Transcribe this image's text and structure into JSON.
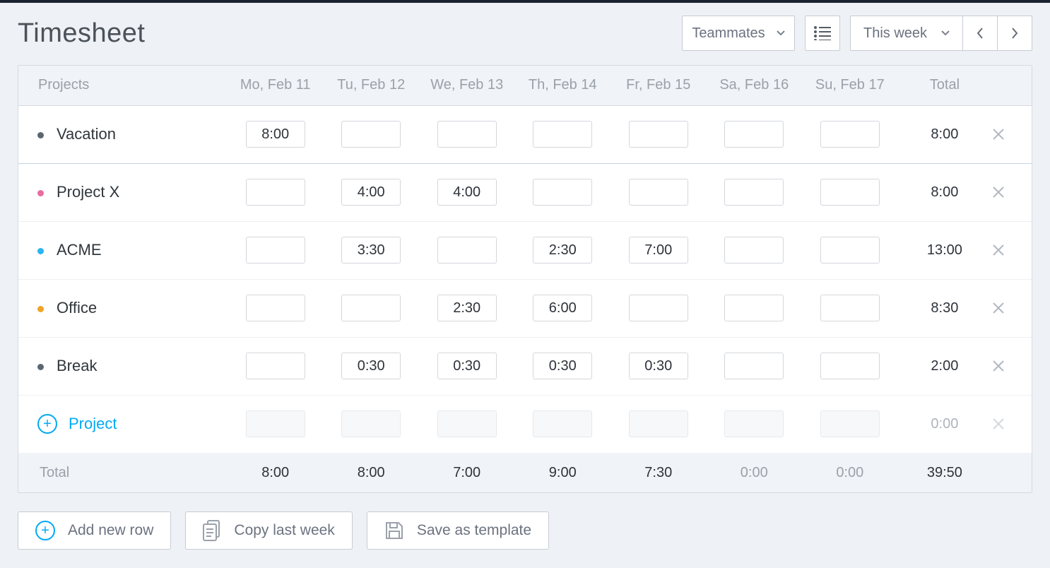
{
  "header": {
    "title": "Timesheet",
    "teammates_label": "Teammates",
    "period_label": "This week"
  },
  "columns": {
    "projects_header": "Projects",
    "days": [
      "Mo, Feb 11",
      "Tu, Feb 12",
      "We, Feb 13",
      "Th, Feb 14",
      "Fr, Feb 15",
      "Sa, Feb 16",
      "Su, Feb 17"
    ],
    "total_header": "Total"
  },
  "rows": [
    {
      "name": "Vacation",
      "color": "#5b6770",
      "cells": [
        "8:00",
        "",
        "",
        "",
        "",
        "",
        ""
      ],
      "total": "8:00"
    },
    {
      "name": "Project X",
      "color": "#e86ca0",
      "cells": [
        "",
        "4:00",
        "4:00",
        "",
        "",
        "",
        ""
      ],
      "total": "8:00"
    },
    {
      "name": "ACME",
      "color": "#2eb4ef",
      "cells": [
        "",
        "3:30",
        "",
        "2:30",
        "7:00",
        "",
        ""
      ],
      "total": "13:00"
    },
    {
      "name": "Office",
      "color": "#f0a32a",
      "cells": [
        "",
        "",
        "2:30",
        "6:00",
        "",
        "",
        ""
      ],
      "total": "8:30"
    },
    {
      "name": "Break",
      "color": "#5b6770",
      "cells": [
        "",
        "0:30",
        "0:30",
        "0:30",
        "0:30",
        "",
        ""
      ],
      "total": "2:00"
    }
  ],
  "new_row": {
    "label": "Project",
    "total": "0:00"
  },
  "footer_totals": {
    "label": "Total",
    "days": [
      "8:00",
      "8:00",
      "7:00",
      "9:00",
      "7:30",
      "0:00",
      "0:00"
    ],
    "grand": "39:50"
  },
  "actions": {
    "add_row": "Add new row",
    "copy_last": "Copy last week",
    "save_template": "Save as template"
  }
}
